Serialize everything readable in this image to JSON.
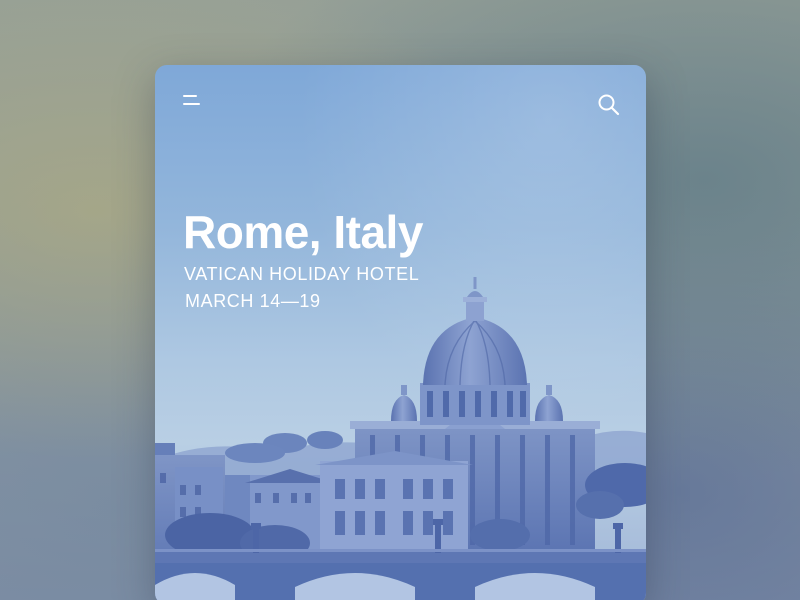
{
  "destination": {
    "title": "Rome, Italy",
    "hotel": "VATICAN HOLIDAY HOTEL",
    "dates": "MARCH 14—19"
  },
  "header": {
    "menu_icon": "hamburger-menu-icon",
    "search_icon": "search-icon"
  },
  "colors": {
    "text": "#ffffff",
    "sky_top": "#7fa8d8",
    "sky_bottom": "#b9cfe4",
    "building": "#5f79b4",
    "building_dark": "#465fa0"
  }
}
